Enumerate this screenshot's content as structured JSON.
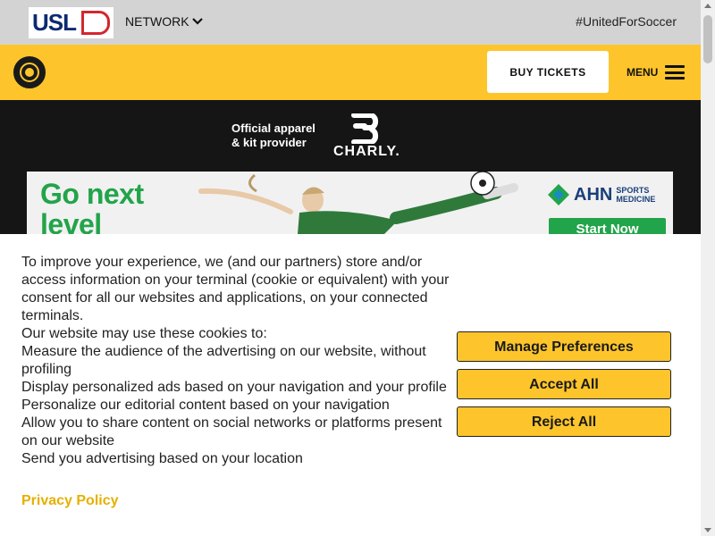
{
  "netbar": {
    "logo_letters": "USL",
    "network_label": "NETWORK",
    "hashtag": "#UnitedForSoccer"
  },
  "header": {
    "buy_tickets": "BUY TICKETS",
    "menu_label": "MENU"
  },
  "sponsor": {
    "apparel_line1": "Official apparel",
    "apparel_line2": "& kit provider",
    "brand": "CHARLY."
  },
  "ad": {
    "headline_line1": "Go next",
    "headline_line2": "level",
    "brand_name": "AHN",
    "brand_sub1": "SPORTS",
    "brand_sub2": "MEDICINE",
    "cta": "Start Now"
  },
  "consent": {
    "paragraphs": [
      "To improve your experience, we (and our partners) store and/or access information on your terminal (cookie or equivalent) with your consent for all our websites and applications, on your connected terminals.",
      "Our website may use these cookies to:",
      "Measure the audience of the advertising on our website, without profiling",
      "Display personalized ads based on your navigation and your profile",
      "Personalize our editorial content based on your navigation",
      "Allow you to share content on social networks or platforms present on our website",
      "Send you advertising based on your location"
    ],
    "privacy_link": "Privacy Policy",
    "manage_button": "Manage Preferences",
    "accept_button": "Accept All",
    "reject_button": "Reject All"
  },
  "colors": {
    "brand_yellow": "#fdc52b",
    "ad_green": "#22a44a",
    "usl_blue": "#0b2a6f",
    "usl_red": "#d3262d"
  }
}
